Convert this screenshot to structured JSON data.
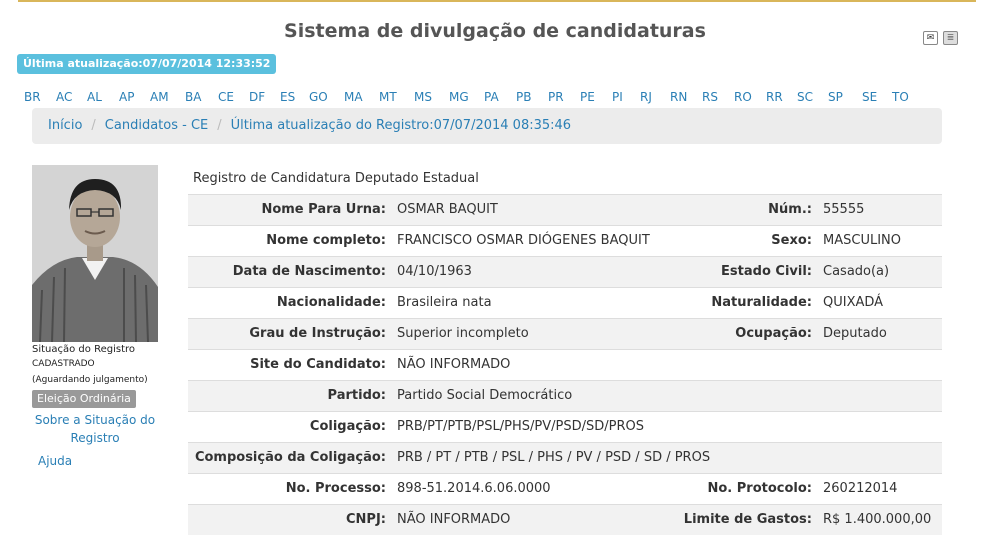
{
  "header": {
    "title": "Sistema de divulgação de candidaturas",
    "last_update": "Última atualização:07/07/2014 12:33:52",
    "icons": [
      "feed-icon",
      "print-icon"
    ]
  },
  "states": [
    "BR",
    "AC",
    "AL",
    "AP",
    "AM",
    "BA",
    "CE",
    "DF",
    "ES",
    "GO",
    "MA",
    "MT",
    "MS",
    "MG",
    "PA",
    "PB",
    "PR",
    "PE",
    "PI",
    "RJ",
    "RN",
    "RS",
    "RO",
    "RR",
    "SC",
    "SP",
    "SE",
    "TO"
  ],
  "breadcrumb": {
    "home": "Início",
    "candidates": "Candidatos - CE",
    "record_update": "Última atualização do Registro:07/07/2014 08:35:46"
  },
  "sidebar": {
    "status_label": "Situação do Registro",
    "status_value": "CADASTRADO",
    "status_detail": "(Aguardando julgamento)",
    "election_badge": "Eleição Ordinária",
    "about_link_line1": "Sobre a Situação do",
    "about_link_line2": "Registro",
    "help_link": "Ajuda"
  },
  "registration": {
    "heading": "Registro de Candidatura Deputado Estadual",
    "rows": [
      {
        "label": "Nome Para Urna:",
        "value": "OSMAR BAQUIT",
        "label2": "Núm.:",
        "value2": "55555"
      },
      {
        "label": "Nome completo:",
        "value": "FRANCISCO OSMAR DIÓGENES BAQUIT",
        "label2": "Sexo:",
        "value2": "MASCULINO"
      },
      {
        "label": "Data de Nascimento:",
        "value": "04/10/1963",
        "label2": "Estado Civil:",
        "value2": "Casado(a)"
      },
      {
        "label": "Nacionalidade:",
        "value": "Brasileira nata",
        "label2": "Naturalidade:",
        "value2": "QUIXADÁ"
      },
      {
        "label": "Grau de Instrução:",
        "value": "Superior incompleto",
        "label2": "Ocupação:",
        "value2": "Deputado"
      },
      {
        "label": "Site do Candidato:",
        "value": "NÃO INFORMADO",
        "label2": "",
        "value2": ""
      },
      {
        "label": "Partido:",
        "value": "Partido Social Democrático",
        "label2": "",
        "value2": ""
      },
      {
        "label": "Coligação:",
        "value": "PRB/PT/PTB/PSL/PHS/PV/PSD/SD/PROS",
        "label2": "",
        "value2": ""
      },
      {
        "label": "Composição da Coligação:",
        "value": "PRB / PT / PTB / PSL / PHS / PV / PSD / SD / PROS",
        "label2": "",
        "value2": ""
      },
      {
        "label": "No. Processo:",
        "value": "898-51.2014.6.06.0000",
        "label2": "No. Protocolo:",
        "value2": "260212014"
      },
      {
        "label": "CNPJ:",
        "value": "NÃO INFORMADO",
        "label2": "Limite de Gastos:",
        "value2": "R$ 1.400.000,00"
      }
    ]
  }
}
